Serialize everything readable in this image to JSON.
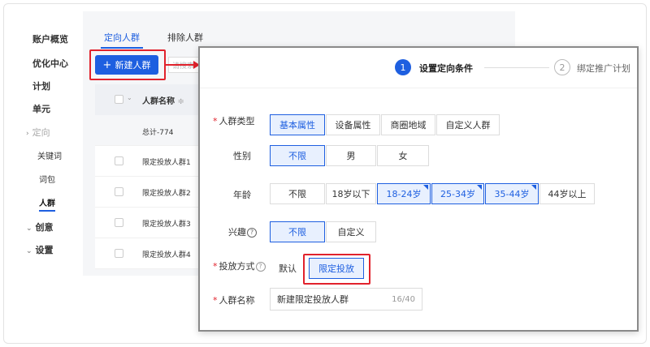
{
  "sidebar": {
    "items": [
      {
        "label": "账户概览"
      },
      {
        "label": "优化中心"
      },
      {
        "label": "计划"
      },
      {
        "label": "单元"
      },
      {
        "label": "定向"
      },
      {
        "label": "关键词"
      },
      {
        "label": "词包"
      },
      {
        "label": "人群"
      },
      {
        "label": "创意"
      },
      {
        "label": "设置"
      }
    ],
    "chevron_right": "›",
    "chevron_down": "⌄"
  },
  "tabs": [
    {
      "label": "定向人群",
      "active": true
    },
    {
      "label": "排除人群",
      "active": false
    }
  ],
  "toolbar": {
    "new_label": "新建人群",
    "plus": "+",
    "search_peek": "请搜索"
  },
  "table": {
    "header": "人群名称",
    "sort_icon": "≑",
    "rows": [
      "总计-774",
      "限定投放人群1",
      "限定投放人群2",
      "限定投放人群3",
      "限定投放人群4"
    ]
  },
  "modal": {
    "steps": [
      {
        "num": "1",
        "label": "设置定向条件",
        "active": true
      },
      {
        "num": "2",
        "label": "绑定推广计划",
        "active": false
      }
    ],
    "fields": {
      "crowd_type": {
        "label": "人群类型",
        "required": true,
        "options": [
          "基本属性",
          "设备属性",
          "商圈地域",
          "自定义人群"
        ],
        "selected": "基本属性"
      },
      "gender": {
        "label": "性别",
        "options": [
          "不限",
          "男",
          "女"
        ],
        "selected": "不限"
      },
      "age": {
        "label": "年龄",
        "options": [
          "不限",
          "18岁以下",
          "18-24岁",
          "25-34岁",
          "35-44岁",
          "44岁以上"
        ],
        "selected": [
          "18-24岁",
          "25-34岁",
          "35-44岁"
        ]
      },
      "interest": {
        "label": "兴趣",
        "help_icon": "?",
        "options": [
          "不限",
          "自定义"
        ],
        "selected": "不限"
      },
      "delivery": {
        "label": "投放方式",
        "required": true,
        "help_icon": "?",
        "options": [
          "默认",
          "限定投放"
        ],
        "selected": "限定投放"
      },
      "crowd_name": {
        "label": "人群名称",
        "required": true,
        "value": "新建限定投放人群",
        "counter": "16/40"
      }
    }
  },
  "colors": {
    "accent": "#1e5fe0",
    "highlight": "#e1222c",
    "selected_bg": "#e8f0fe"
  }
}
